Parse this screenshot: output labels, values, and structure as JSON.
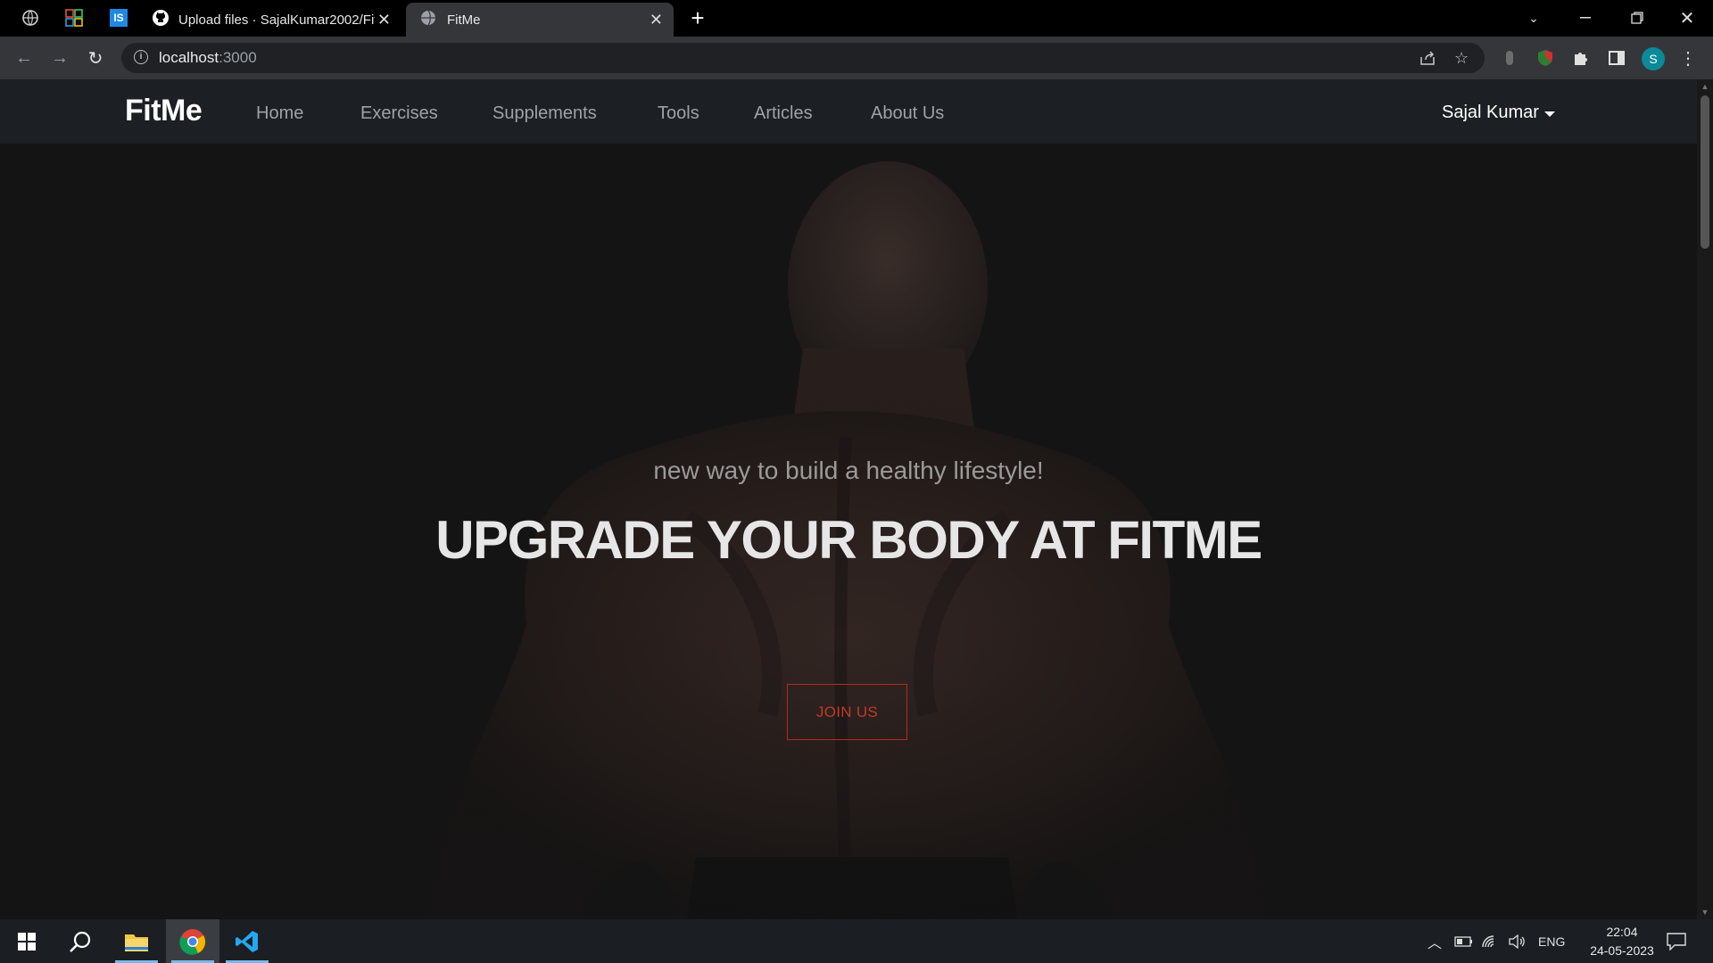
{
  "browser": {
    "tabs": [
      {
        "title": "Upload files · SajalKumar2002/Fit",
        "active": false,
        "icon": "github-icon"
      },
      {
        "title": "FitMe",
        "active": true,
        "icon": "globe-icon"
      }
    ],
    "address": {
      "host": "localhost",
      "port": ":3000"
    },
    "profile_initial": "S"
  },
  "site": {
    "brand": "FitMe",
    "nav": [
      "Home",
      "Exercises",
      "Supplements",
      "Tools",
      "Articles",
      "About Us"
    ],
    "user": "Sajal Kumar"
  },
  "hero": {
    "subtitle": "new way to build a healthy lifestyle!",
    "title": "UPGRADE YOUR BODY AT FITME",
    "cta": "JOIN US"
  },
  "taskbar": {
    "language": "ENG",
    "time": "22:04",
    "date": "24-05-2023"
  },
  "colors": {
    "page_bg": "#141414",
    "navbar_bg": "#1c1f23",
    "cta_border": "#b52a1a",
    "cta_text": "#c23a25"
  }
}
